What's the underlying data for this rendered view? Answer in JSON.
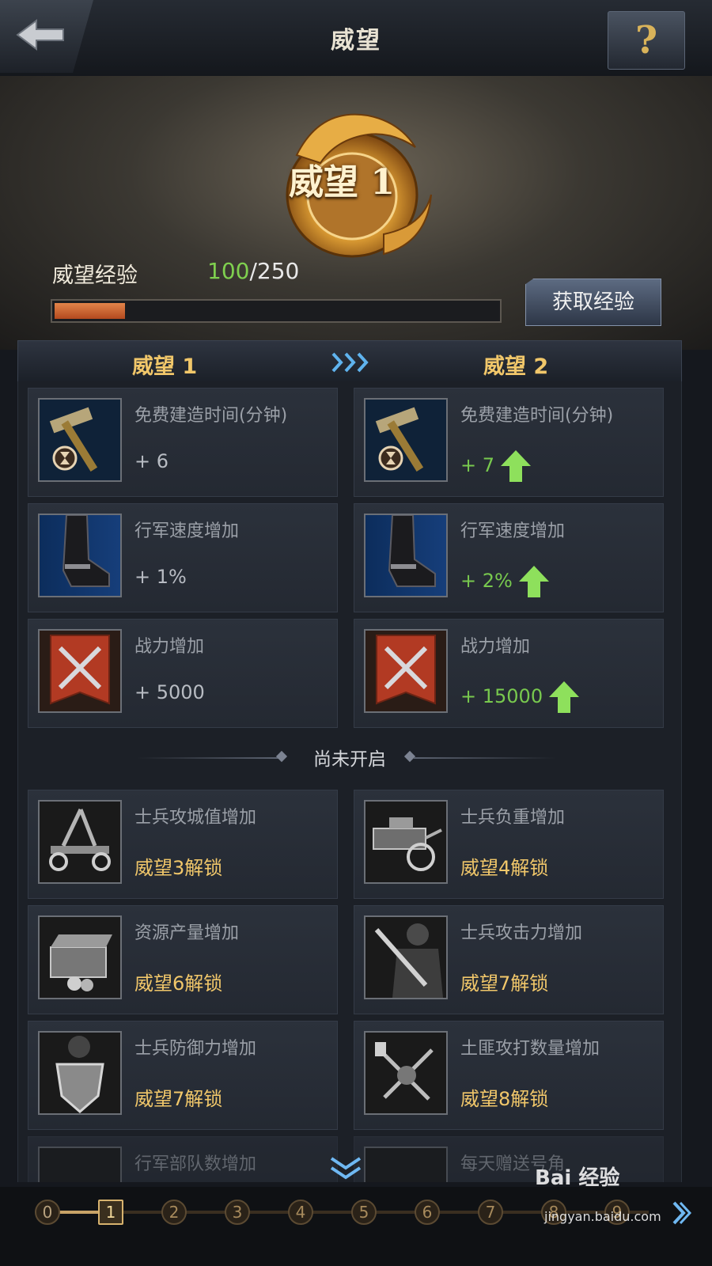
{
  "header": {
    "title": "威望",
    "help_label": "?"
  },
  "banner": {
    "medal_label": "威望 1",
    "exp_label": "威望经验",
    "exp_current": "100",
    "exp_max": "/250",
    "exp_progress": 0.4,
    "get_exp_button": "获取经验"
  },
  "levels": {
    "current": "威望 1",
    "next": "威望 2"
  },
  "bonuses": [
    {
      "name": "免费建造时间(分钟)",
      "current": "+ 6",
      "next": "+ 7",
      "icon": "hammer-hourglass-icon"
    },
    {
      "name": "行军速度增加",
      "current": "+ 1%",
      "next": "+ 2%",
      "icon": "boot-icon"
    },
    {
      "name": "战力增加",
      "current": "+ 5000",
      "next": "+ 15000",
      "icon": "crossed-swords-banner-icon"
    }
  ],
  "locked_section_label": "尚未开启",
  "locked": [
    {
      "name": "士兵攻城值增加",
      "unlock": "威望3解锁",
      "icon": "catapult-icon"
    },
    {
      "name": "士兵负重增加",
      "unlock": "威望4解锁",
      "icon": "cart-icon"
    },
    {
      "name": "资源产量增加",
      "unlock": "威望6解锁",
      "icon": "treasure-chest-icon"
    },
    {
      "name": "士兵攻击力增加",
      "unlock": "威望7解锁",
      "icon": "swordsman-icon"
    },
    {
      "name": "士兵防御力增加",
      "unlock": "威望7解锁",
      "icon": "shield-soldier-icon"
    },
    {
      "name": "土匪攻打数量增加",
      "unlock": "威望8解锁",
      "icon": "bandit-weapons-icon"
    },
    {
      "name": "行军部队数增加",
      "unlock": "",
      "icon": "troops-icon"
    },
    {
      "name": "每天赠送号角",
      "unlock": "",
      "icon": "horn-icon"
    }
  ],
  "track": {
    "nodes": [
      "0",
      "1",
      "2",
      "3",
      "4",
      "5",
      "6",
      "7",
      "8",
      "9"
    ],
    "active_index": 1
  },
  "watermark": {
    "brand": "Bai 经验",
    "url": "jingyan.baidu.com"
  },
  "colors": {
    "accent_gold": "#f1c76a",
    "increase_green": "#78c94e",
    "progress_orange": "#d86a35"
  }
}
